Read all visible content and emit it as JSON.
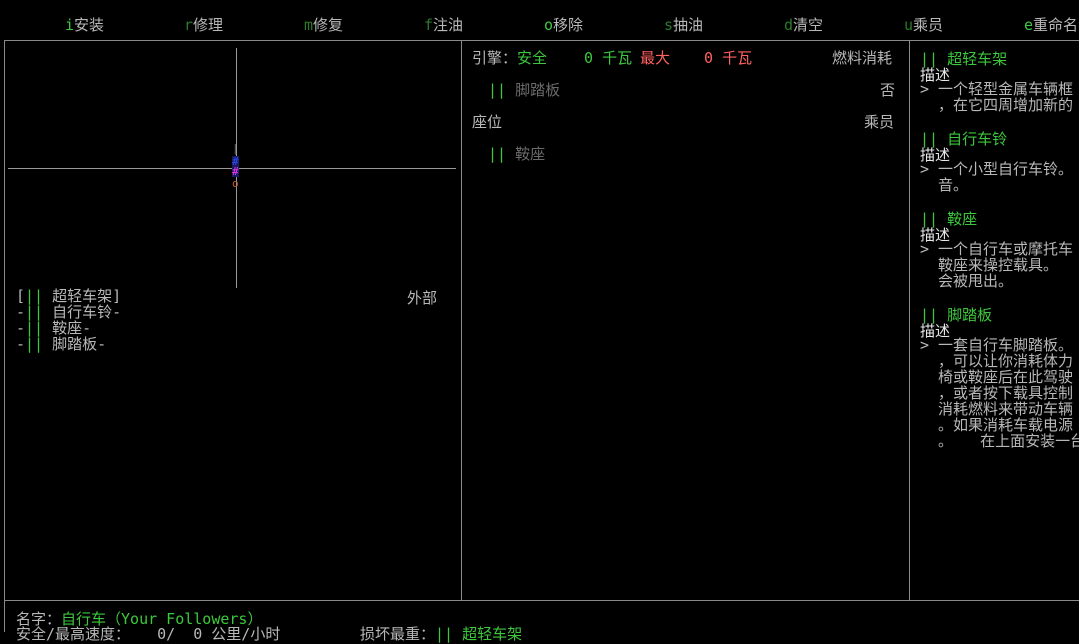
{
  "menu": [
    {
      "key": "i",
      "label": "安装"
    },
    {
      "key": "r",
      "label": "修理"
    },
    {
      "key": "m",
      "label": "修复"
    },
    {
      "key": "f",
      "label": "注油"
    },
    {
      "key": "o",
      "label": "移除"
    },
    {
      "key": "s",
      "label": "抽油"
    },
    {
      "key": "d",
      "label": "清空"
    },
    {
      "key": "u",
      "label": "乘员"
    },
    {
      "key": "e",
      "label": "重命名"
    }
  ],
  "map": {
    "mark_top": "|",
    "cell_top": "#",
    "cell_bottom": "#",
    "mark_bottom": "o"
  },
  "parts_list": {
    "location": "外部",
    "items": [
      {
        "prefix": "[",
        "marker": "||",
        "name": "超轻车架",
        "suffix": "]"
      },
      {
        "prefix": "-",
        "marker": "||",
        "name": "自行车铃",
        "suffix": "-"
      },
      {
        "prefix": "-",
        "marker": "||",
        "name": "鞍座",
        "suffix": "-"
      },
      {
        "prefix": "-",
        "marker": "||",
        "name": "脚踏板",
        "suffix": "-"
      }
    ]
  },
  "engine": {
    "label": "引擎：",
    "status": "安全",
    "current_value": "0",
    "current_unit": "千瓦",
    "max_label": "最大",
    "max_value": "0",
    "max_unit": "千瓦",
    "fuel_label": "燃料消耗",
    "part_marker": "||",
    "part_name": "脚踏板",
    "part_value": "否"
  },
  "seat": {
    "label": "座位",
    "occupant_label": "乘员",
    "part_marker": "||",
    "part_name": "鞍座"
  },
  "descriptions": [
    {
      "marker": "||",
      "name": "超轻车架",
      "heading": "描述",
      "lines": [
        "> 一个轻型金属车辆框",
        "  ，在它四周增加新的"
      ]
    },
    {
      "marker": "||",
      "name": "自行车铃",
      "heading": "描述",
      "lines": [
        "> 一个小型自行车铃。",
        "  音。"
      ]
    },
    {
      "marker": "||",
      "name": "鞍座",
      "heading": "描述",
      "lines": [
        "> 一个自行车或摩托车",
        "  鞍座来操控载具。",
        "  会被甩出。"
      ]
    },
    {
      "marker": "||",
      "name": "脚踏板",
      "heading": "描述",
      "lines": [
        "> 一套自行车脚踏板。",
        "  ，可以让你消耗体力",
        "  椅或鞍座后在此驾驶",
        "  ，或者按下载具控制",
        "  消耗燃料来带动车辆",
        "  。如果消耗车载电源",
        "  。   在上面安装一台"
      ]
    }
  ],
  "footer": {
    "name_label": "名字：",
    "name_value": "自行车",
    "owner": "（Your Followers）",
    "line2_left": "安全/最高速度：   0/  0 公里/小时",
    "line2_right_label": "损坏最重：",
    "line2_right_marker": "||",
    "line2_right_value": "超轻车架"
  },
  "colors": {
    "background": "#000000",
    "frame": "#8a8a8a",
    "hotkey": "#3cc83c",
    "text": "#b8b8b8",
    "warning": "#ff6060"
  }
}
